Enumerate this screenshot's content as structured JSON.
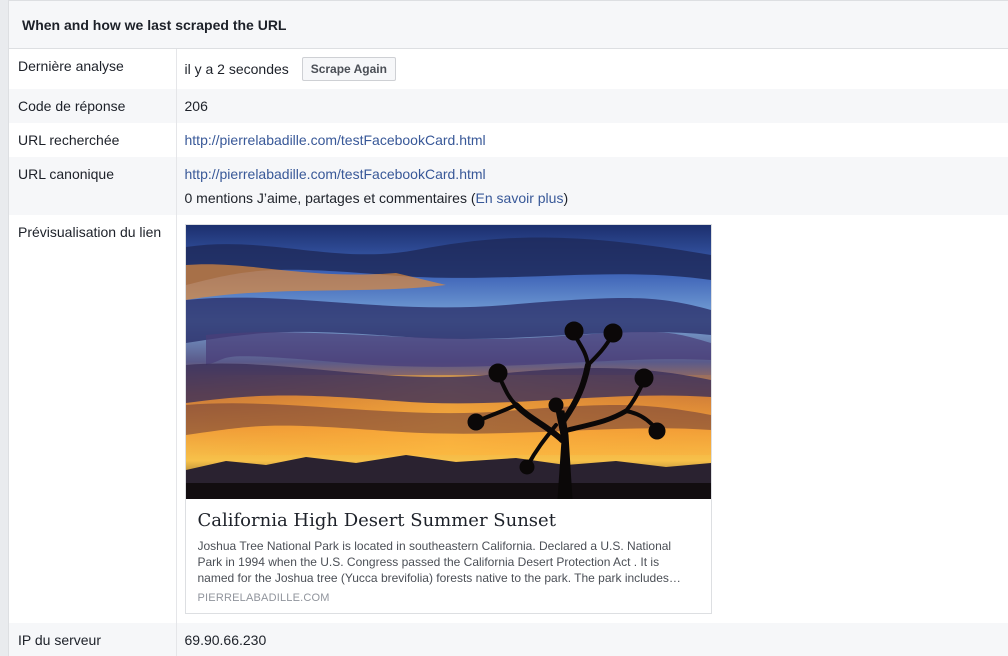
{
  "header": {
    "title": "When and how we last scraped the URL"
  },
  "rows": {
    "last_scrape": {
      "label": "Dernière analyse",
      "value": "il y a 2 secondes",
      "button": "Scrape Again"
    },
    "response_code": {
      "label": "Code de réponse",
      "value": "206"
    },
    "fetched_url": {
      "label": "URL recherchée",
      "value": "http://pierrelabadille.com/testFacebookCard.html"
    },
    "canonical_url": {
      "label": "URL canonique",
      "value": "http://pierrelabadille.com/testFacebookCard.html",
      "stats_text": "0 mentions J’aime, partages et commentaires (",
      "learn_more": "En savoir plus",
      "stats_close": ")"
    },
    "link_preview": {
      "label": "Prévisualisation du lien",
      "title": "California High Desert Summer Sunset",
      "description": "Joshua Tree National Park is located in southeastern California. Declared a U.S. National Park in 1994 when the U.S. Congress passed the California Desert Protection Act . It is named for the Joshua tree (Yucca brevifolia) forests native to the park. The park includes…",
      "domain": "PIERRELABADILLE.COM"
    },
    "server_ip": {
      "label": "IP du serveur",
      "value": "69.90.66.230"
    }
  },
  "colors": {
    "link": "#385898",
    "header_bg": "#f6f7f9",
    "alt_row_bg": "#f6f7f9"
  }
}
